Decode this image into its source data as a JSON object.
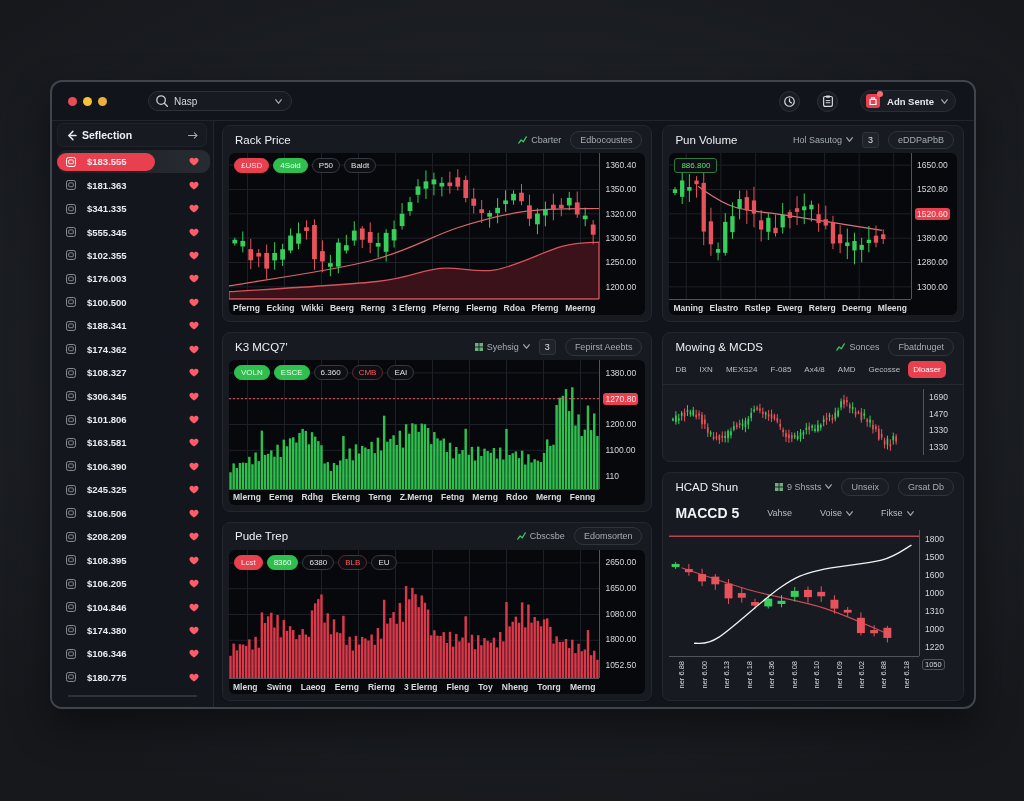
{
  "toolbar": {
    "search": {
      "value": "Nasp"
    },
    "user": {
      "name": "Adn Sente",
      "notification": true
    }
  },
  "sidebar": {
    "title": "Seflection",
    "items": [
      {
        "value": "$183.555",
        "selected": true
      },
      {
        "value": "$181.363",
        "selected": false
      },
      {
        "value": "$341.335",
        "selected": false
      },
      {
        "value": "$555.345",
        "selected": false
      },
      {
        "value": "$102.355",
        "selected": false
      },
      {
        "value": "$176.003",
        "selected": false
      },
      {
        "value": "$100.500",
        "selected": false
      },
      {
        "value": "$188.341",
        "selected": false
      },
      {
        "value": "$174.362",
        "selected": false
      },
      {
        "value": "$108.327",
        "selected": false
      },
      {
        "value": "$306.345",
        "selected": false
      },
      {
        "value": "$101.806",
        "selected": false
      },
      {
        "value": "$163.581",
        "selected": false
      },
      {
        "value": "$106.390",
        "selected": false
      },
      {
        "value": "$245.325",
        "selected": false
      },
      {
        "value": "$106.506",
        "selected": false
      },
      {
        "value": "$208.209",
        "selected": false
      },
      {
        "value": "$108.395",
        "selected": false
      },
      {
        "value": "$106.205",
        "selected": false
      },
      {
        "value": "$104.846",
        "selected": false
      },
      {
        "value": "$174.380",
        "selected": false
      },
      {
        "value": "$106.346",
        "selected": false
      },
      {
        "value": "$180.775",
        "selected": false
      }
    ]
  },
  "left_column": [
    {
      "kind": "candles-area",
      "title": "Rack Price",
      "actions": [
        {
          "kind": "link",
          "label": "Cbarter"
        },
        {
          "kind": "button",
          "label": "Edbocoustes"
        }
      ],
      "chips": [
        {
          "kind": "sell",
          "label": "£USD"
        },
        {
          "kind": "buy",
          "label": "4Sold"
        },
        {
          "kind": "plain",
          "label": "P50"
        },
        {
          "kind": "plain",
          "label": "Baldt"
        }
      ],
      "y_ticks": [
        {
          "label": "1360.40",
          "highlight": false
        },
        {
          "label": "1350.00",
          "highlight": false
        },
        {
          "label": "1320.00",
          "highlight": false
        },
        {
          "label": "1300.50",
          "highlight": false
        },
        {
          "label": "1250.00",
          "highlight": false
        },
        {
          "label": "1200.00",
          "highlight": false
        }
      ],
      "x_labels": [
        "Pferng",
        "Ecking",
        "Wikki",
        "Beerg",
        "Rerng",
        "3 Eferng",
        "Pferng",
        "Fleerng",
        "Rdoa",
        "Pferng",
        "Meerng"
      ]
    },
    {
      "kind": "histogram",
      "color": "#2fbf4f",
      "title": "K3 MCQ7'",
      "actions": [
        {
          "kind": "iconmenu",
          "label": "Syehsig"
        },
        {
          "kind": "square",
          "label": "3"
        },
        {
          "kind": "button",
          "label": "Fepirst Aeebts"
        }
      ],
      "chips": [
        {
          "kind": "buy",
          "label": "VOLN"
        },
        {
          "kind": "buy",
          "label": "ESCE"
        },
        {
          "kind": "plain",
          "label": "6.360"
        },
        {
          "kind": "alert",
          "label": "CMB"
        },
        {
          "kind": "plain",
          "label": "EAI"
        }
      ],
      "y_ticks": [
        {
          "label": "1380.00",
          "highlight": false
        },
        {
          "label": "1270.80",
          "highlight": true
        },
        {
          "label": "1200.00",
          "highlight": false
        },
        {
          "label": "1100.00",
          "highlight": false
        },
        {
          "label": "110",
          "highlight": false
        }
      ],
      "x_labels": [
        "Mlerng",
        "Eerng",
        "Rdhg",
        "Ekerng",
        "Terng",
        "Z.Merng",
        "Fetng",
        "Merng",
        "Rdoo",
        "Merng",
        "Fenng"
      ]
    },
    {
      "kind": "histogram",
      "color": "#d9394a",
      "title": "Pude Trep",
      "actions": [
        {
          "kind": "link",
          "label": "Cbscsbe"
        },
        {
          "kind": "button",
          "label": "Edomsorten"
        }
      ],
      "chips": [
        {
          "kind": "sell",
          "label": "Lcst"
        },
        {
          "kind": "buy",
          "label": "8360"
        },
        {
          "kind": "plain",
          "label": "6380"
        },
        {
          "kind": "alert",
          "label": "BLB"
        },
        {
          "kind": "plain",
          "label": "EU"
        }
      ],
      "y_ticks": [
        {
          "label": "2650.00",
          "highlight": false
        },
        {
          "label": "1650.00",
          "highlight": false
        },
        {
          "label": "1080.00",
          "highlight": false
        },
        {
          "label": "1800.00",
          "highlight": false
        },
        {
          "label": "1052.50",
          "highlight": false
        }
      ],
      "x_labels": [
        "Mleng",
        "Swing",
        "Laeog",
        "Eerng",
        "Rierng",
        "3 Elerng",
        "Fleng",
        "Toy",
        "Nheng",
        "Tonrg",
        "Merng"
      ]
    }
  ],
  "right_column": [
    {
      "kind": "candles",
      "title": "Pun Volume",
      "actions": [
        {
          "kind": "menu",
          "label": "Hol Sasutog"
        },
        {
          "kind": "square",
          "label": "3"
        },
        {
          "kind": "button",
          "label": "eDDPaPbB"
        }
      ],
      "chips": [
        {
          "kind": "signal",
          "label": "886.800"
        }
      ],
      "y_ticks": [
        {
          "label": "1650.00",
          "highlight": false
        },
        {
          "label": "1520.80",
          "highlight": false
        },
        {
          "label": "1520.60",
          "highlight": true
        },
        {
          "label": "1380.00",
          "highlight": false
        },
        {
          "label": "1280.00",
          "highlight": false
        },
        {
          "label": "1300.00",
          "highlight": false
        }
      ],
      "x_labels": [
        "Maning",
        "Elastro",
        "Rstlep",
        "Ewerg",
        "Reterg",
        "Deerng",
        "Mleeng"
      ]
    },
    {
      "kind": "ticker",
      "title": "Mowing & MCDS",
      "actions": [
        {
          "kind": "link",
          "label": "Sonces"
        },
        {
          "kind": "button",
          "label": "Fbatdnuget"
        }
      ],
      "tabs": [
        {
          "label": "DB",
          "selected": false
        },
        {
          "label": "IXN",
          "selected": false
        },
        {
          "label": "MEXS24",
          "selected": false
        },
        {
          "label": "F-085",
          "selected": false
        },
        {
          "label": "Ax4/8",
          "selected": false
        },
        {
          "label": "AMD",
          "selected": false
        },
        {
          "label": "Gecosse",
          "selected": false
        },
        {
          "label": "Dloaser",
          "selected": true
        }
      ],
      "y_ticks": [
        {
          "label": "1690",
          "highlight": false
        },
        {
          "label": "1470",
          "highlight": false
        },
        {
          "label": "1330",
          "highlight": false
        },
        {
          "label": "1330",
          "highlight": false
        }
      ]
    },
    {
      "kind": "macd",
      "title": "HCAD Shun",
      "actions": [
        {
          "kind": "iconmenu",
          "label": "9 Shssts"
        },
        {
          "kind": "button",
          "label": "Unseix"
        },
        {
          "kind": "button",
          "label": "Grsat Db"
        }
      ],
      "subheader": {
        "title": "MACCD 5",
        "options": [
          {
            "kind": "plain",
            "label": "Vahse"
          },
          {
            "kind": "menu",
            "label": "Voise"
          },
          {
            "kind": "menu",
            "label": "Fikse"
          }
        ]
      },
      "y_ticks": [
        {
          "label": "1800",
          "highlight": false
        },
        {
          "label": "1500",
          "highlight": false
        },
        {
          "label": "1600",
          "highlight": false
        },
        {
          "label": "1000",
          "highlight": false
        },
        {
          "label": "1310",
          "highlight": false
        },
        {
          "label": "1000",
          "highlight": false
        },
        {
          "label": "1220",
          "highlight": false
        }
      ],
      "axis_badge": "1050",
      "x_labels": [
        "ner 6.88",
        "ner 6.00",
        "ner 6.13",
        "ner 6.18",
        "ner 6.36",
        "ner 6.08",
        "ner 6.10",
        "ner 6.09",
        "ner 6.02",
        "ner 6.88",
        "ner 6.18"
      ]
    }
  ]
}
